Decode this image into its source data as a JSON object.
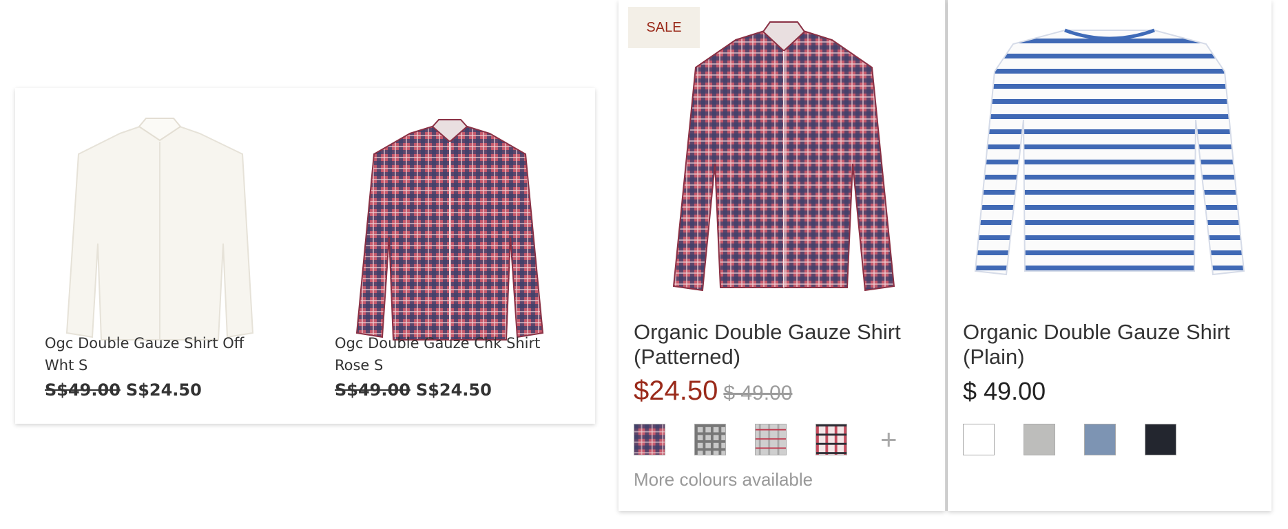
{
  "left_group": {
    "items": [
      {
        "name": "Ogc Double Gauze Shirt Off Wht S",
        "old_price": "S$49.00",
        "price": "S$24.50",
        "image": "white-shirt"
      },
      {
        "name": "Ogc Double Gauze Chk Shirt Rose S",
        "old_price": "S$49.00",
        "price": "S$24.50",
        "image": "checked-shirt"
      }
    ]
  },
  "cards": [
    {
      "badge": "SALE",
      "name": "Organic Double Gauze Shirt (Patterned)",
      "price": "$24.50",
      "old_price": "$ 49.00",
      "swatch_colors": [
        "#b8455a",
        "#9a9a9a",
        "#b5b5b5",
        "#d6b8bb"
      ],
      "plus": "+",
      "more_text": "More colours available"
    },
    {
      "name": "Organic Double Gauze Shirt (Plain)",
      "price": "$ 49.00",
      "swatch_colors": [
        "#ffffff",
        "#bdbdbb",
        "#7d94b3",
        "#23262f"
      ]
    }
  ],
  "colors": {
    "sale_red": "#9a2a1a",
    "stripe_blue": "#3f6bb8",
    "check_red": "#c04a5f",
    "check_navy": "#3a3f6b"
  }
}
